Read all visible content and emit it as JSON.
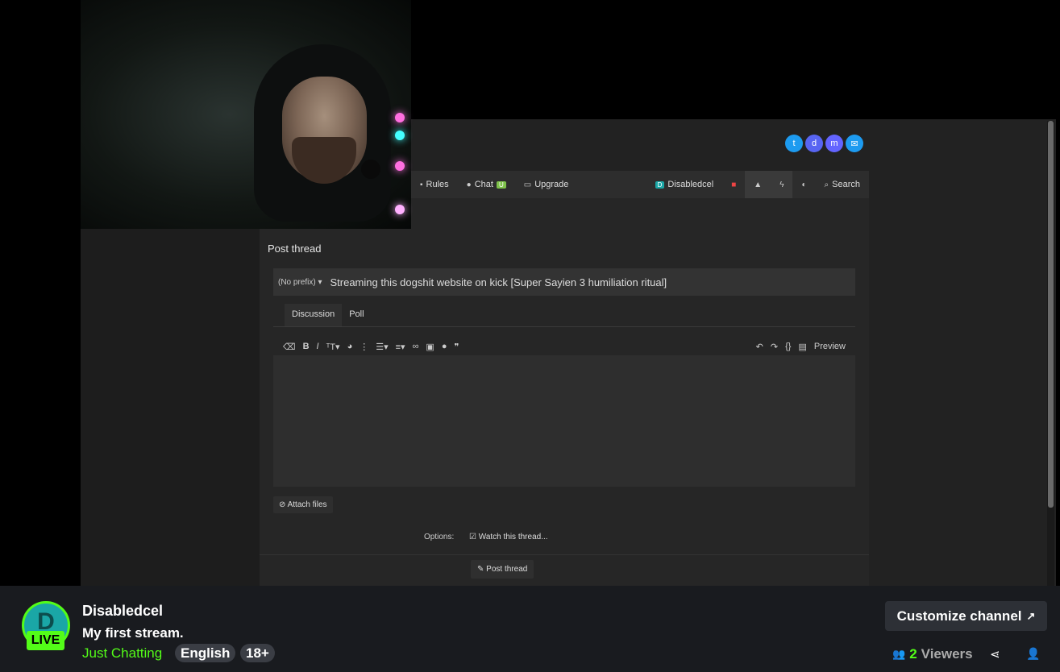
{
  "forum": {
    "nav": {
      "rules": "Rules",
      "chat": "Chat",
      "chat_badge": "U",
      "upgrade": "Upgrade",
      "user": "Disabledcel",
      "search": "Search"
    },
    "post_heading": "Post thread",
    "prefix": "(No prefix) ▾",
    "thread_title": "Streaming this dogshit website on kick [Super Sayien 3 humiliation ritual]",
    "tabs": [
      "Discussion",
      "Poll"
    ],
    "preview": "Preview",
    "attach": "Attach files",
    "options_label": "Options:",
    "watch": "Watch this thread...",
    "submit": "Post thread"
  },
  "channel": {
    "name": "Disabledcel",
    "avatar_letter": "D",
    "live_label": "LIVE",
    "stream_title": "My first stream.",
    "category": "Just Chatting",
    "language": "English",
    "age_tag": "18+"
  },
  "actions": {
    "customize": "Customize channel",
    "viewer_count": "2",
    "viewers_label": "Viewers"
  },
  "colors": {
    "accent": "#53fc18",
    "bar_bg": "#191b1f"
  },
  "icons": [
    "external-link-icon",
    "viewers-icon",
    "share-icon",
    "follow-icon"
  ]
}
